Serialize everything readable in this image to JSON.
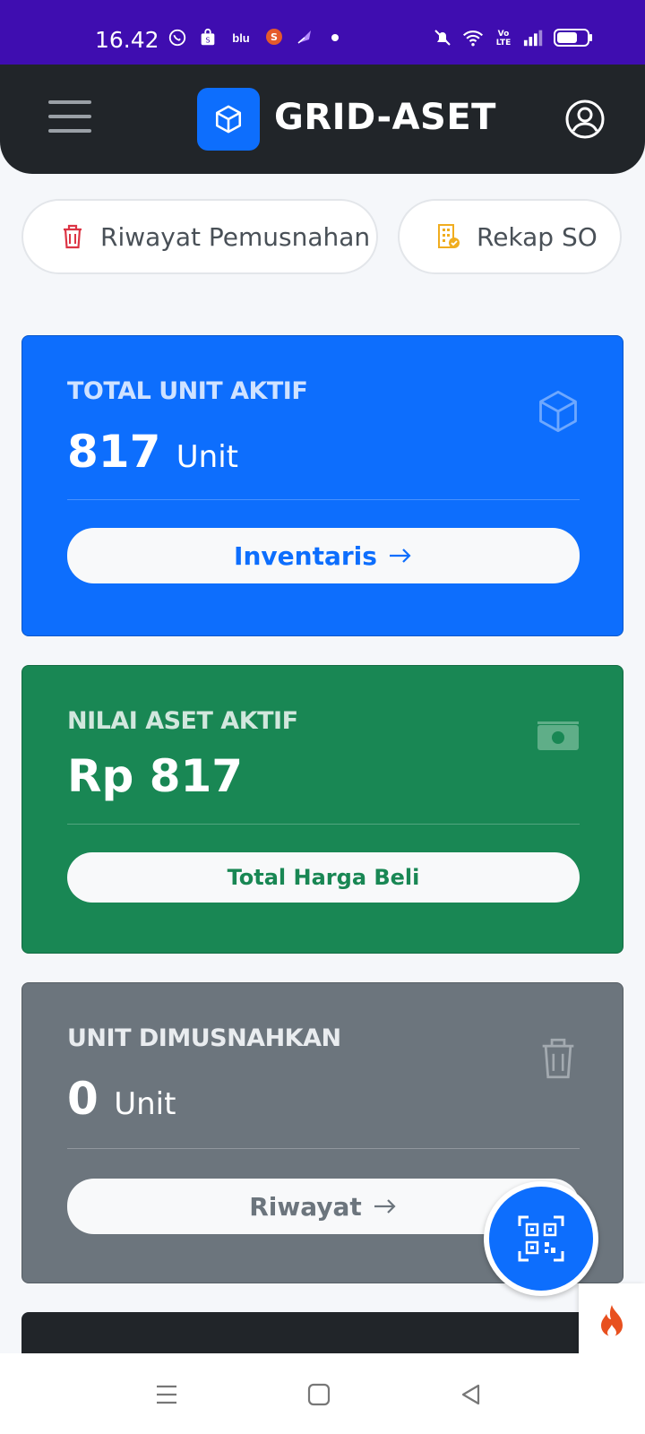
{
  "status_bar": {
    "time": "16.42",
    "icons_left": [
      "whatsapp-icon",
      "shop-icon",
      "blu-icon",
      "s-app-icon",
      "feather-app-icon",
      "dot-icon"
    ],
    "icons_right": [
      "mute-icon",
      "wifi-icon",
      "volte-icon",
      "signal-icon",
      "battery-icon"
    ],
    "blu_label": "blu"
  },
  "header": {
    "title": "GRID-ASET"
  },
  "quick_links": [
    {
      "label": "Riwayat Pemusnahan",
      "icon": "trash-icon"
    },
    {
      "label": "Rekap SO",
      "icon": "building-check-icon"
    }
  ],
  "cards": {
    "total_unit": {
      "title": "TOTAL UNIT AKTIF",
      "value": "817",
      "unit": "Unit",
      "button": "Inventaris",
      "color": "#0d6efd"
    },
    "nilai_aset": {
      "title": "NILAI ASET AKTIF",
      "value": "Rp 817",
      "button": "Total Harga Beli",
      "color": "#198754"
    },
    "dimusnahkan": {
      "title": "UNIT DIMUSNAHKAN",
      "value": "0",
      "unit": "Unit",
      "button": "Riwayat",
      "color": "#6c757d"
    }
  },
  "fab": {
    "icon": "qr-scan-icon"
  },
  "nav_bar": {
    "icons": [
      "menu-icon",
      "home-square-icon",
      "back-icon"
    ]
  }
}
